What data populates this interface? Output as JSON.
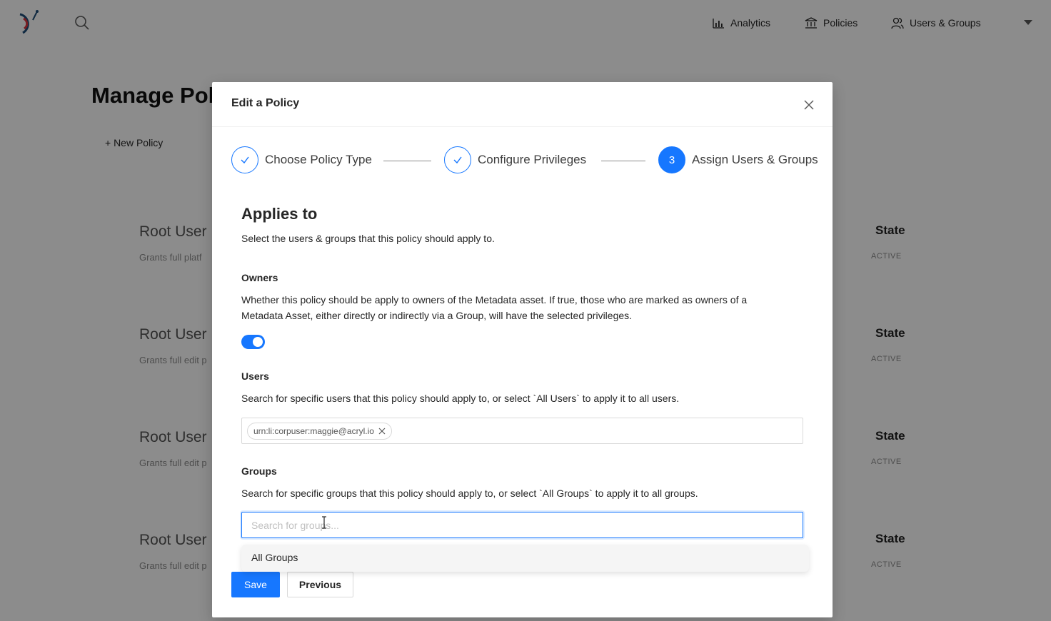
{
  "app": {
    "nav": {
      "analytics": "Analytics",
      "policies": "Policies",
      "users_groups": "Users & Groups"
    },
    "page_title": "Manage Poli",
    "new_policy": "+ New Policy",
    "rows": [
      {
        "name": "Root User",
        "desc": "Grants full platf",
        "state_header": "State",
        "state": "ACTIVE"
      },
      {
        "name": "Root User",
        "desc": "Grants full edit p",
        "state_header": "State",
        "state": "ACTIVE"
      },
      {
        "name": "Root User",
        "desc": "Grants full edit p",
        "state_header": "State",
        "state": "ACTIVE"
      },
      {
        "name": "Root User",
        "desc": "Grants full edit p",
        "state_header": "State",
        "state": "ACTIVE"
      }
    ]
  },
  "modal": {
    "title": "Edit a Policy",
    "steps": [
      {
        "label": "Choose Policy Type",
        "status": "done"
      },
      {
        "label": "Configure Privileges",
        "status": "done"
      },
      {
        "label": "Assign Users & Groups",
        "status": "active",
        "number": "3"
      }
    ],
    "applies_to": {
      "title": "Applies to",
      "subtitle": "Select the users & groups that this policy should apply to."
    },
    "owners": {
      "label": "Owners",
      "description": "Whether this policy should be apply to owners of the Metadata asset. If true, those who are marked as owners of a Metadata Asset, either directly or indirectly via a Group, will have the selected privileges.",
      "enabled": true
    },
    "users": {
      "label": "Users",
      "description": "Search for specific users that this policy should apply to, or select `All Users` to apply it to all users.",
      "selected": [
        "urn:li:corpuser:maggie@acryl.io"
      ]
    },
    "groups": {
      "label": "Groups",
      "description": "Search for specific groups that this policy should apply to, or select `All Groups` to apply it to all groups.",
      "placeholder": "Search for groups...",
      "value": "",
      "dropdown_options": [
        "All Groups"
      ]
    },
    "buttons": {
      "save": "Save",
      "previous": "Previous"
    }
  },
  "colors": {
    "primary": "#1677ff",
    "overlay": "rgba(0,0,0,0.45)"
  }
}
